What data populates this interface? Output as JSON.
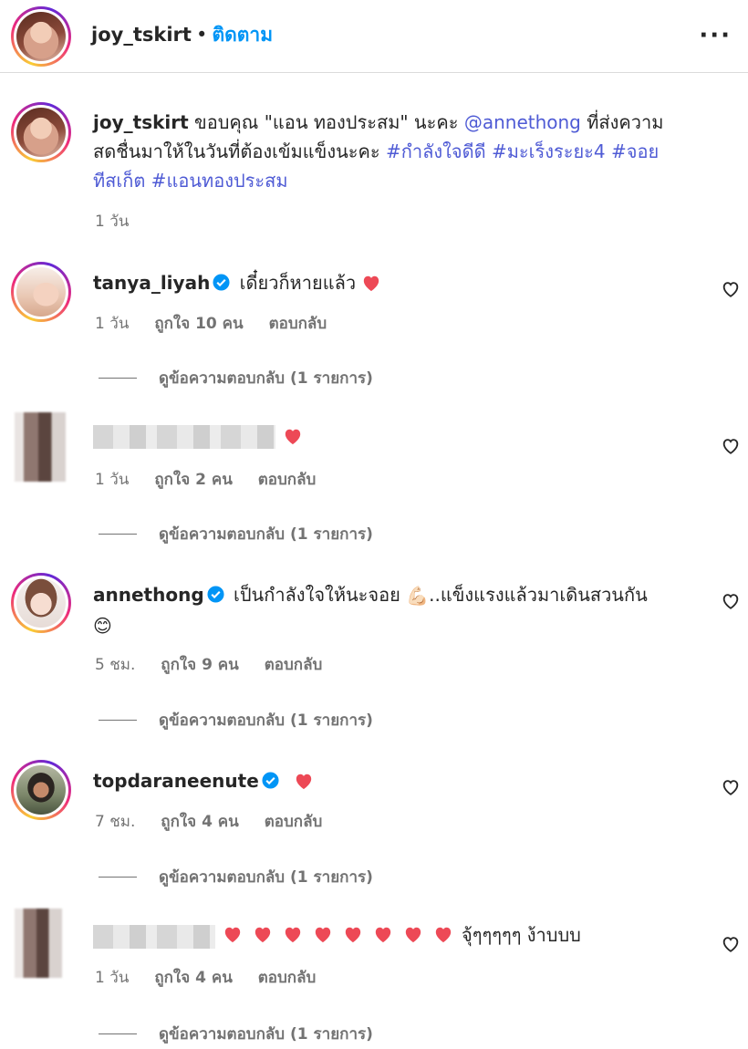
{
  "post": {
    "author": "joy_tskirt",
    "separator": "•",
    "follow_label": "ติดตาม",
    "more_label": "···"
  },
  "caption": {
    "username": "joy_tskirt",
    "text_1": "ขอบคุณ \"แอน ทองประสม\" นะคะ",
    "mention": "@annethong",
    "text_2": "ที่ส่งความ",
    "text_3": "สดชื่นมาให้ในวันที่ต้องเข้มแข็งนะคะ",
    "tags_line2": "#กำลังใจดีดี #มะเร็งระยะ4 #จอย",
    "tags_line3": "ทีสเก็ต #แอนทองประสม",
    "time": "1 วัน"
  },
  "comments": [
    {
      "username": "tanya_liyah",
      "verified": true,
      "text": "เดี๋ยวก็หายแล้ว",
      "emoji": "heart",
      "time": "1 วัน",
      "likes": "ถูกใจ 10 คน",
      "reply": "ตอบกลับ",
      "view_replies": "ดูข้อความตอบกลับ (1 รายการ)"
    },
    {
      "username": "",
      "verified": false,
      "text": "",
      "emoji": "heart",
      "time": "1 วัน",
      "likes": "ถูกใจ 2 คน",
      "reply": "ตอบกลับ",
      "view_replies": "ดูข้อความตอบกลับ (1 รายการ)"
    },
    {
      "username": "annethong",
      "verified": true,
      "text_a": "เป็นกำลังใจให้นะจอย",
      "emoji_a": "💪🏻",
      "text_b": "..แข็งแรงแล้วมาเดินสวนกัน",
      "emoji_b": "😊",
      "time": "5 ชม.",
      "likes": "ถูกใจ 9 คน",
      "reply": "ตอบกลับ",
      "view_replies": "ดูข้อความตอบกลับ (1 รายการ)"
    },
    {
      "username": "topdaraneenute",
      "verified": true,
      "text": "",
      "emoji": "heart",
      "time": "7 ชม.",
      "likes": "ถูกใจ 4 คน",
      "reply": "ตอบกลับ",
      "view_replies": "ดูข้อความตอบกลับ (1 รายการ)"
    },
    {
      "username": "",
      "verified": false,
      "hearts": 8,
      "text": "จุ้ๆๆๆๆๆ ง้าบบบ",
      "time": "1 วัน",
      "likes": "ถูกใจ 4 คน",
      "reply": "ตอบกลับ",
      "view_replies": "ดูข้อความตอบกลับ (1 รายการ)"
    }
  ],
  "colors": {
    "link": "#4f5bd5",
    "follow": "#0095f6",
    "verified": "#0095f6",
    "heart": "#ed4956",
    "meta": "#737373"
  }
}
